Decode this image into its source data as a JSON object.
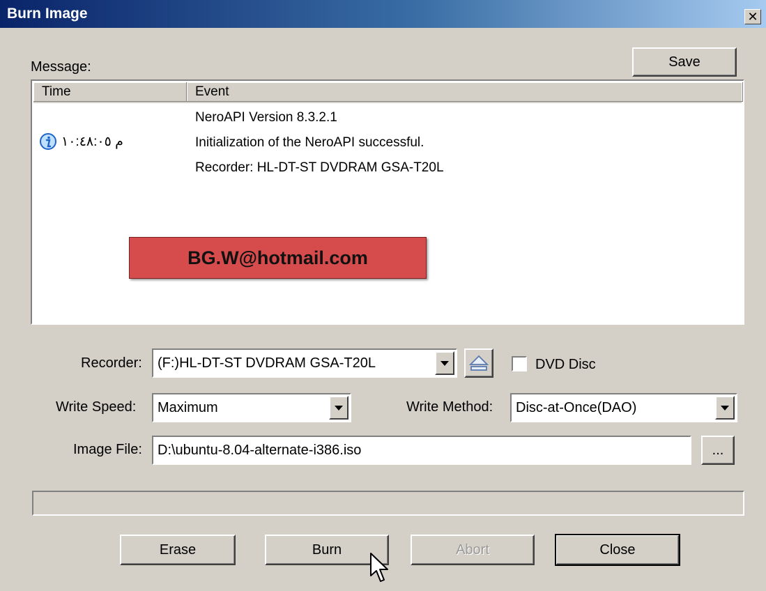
{
  "window": {
    "title": "Burn Image",
    "close_glyph": "✕"
  },
  "message": {
    "label": "Message:",
    "save_label": "Save",
    "columns": [
      "Time",
      "Event"
    ],
    "entry": {
      "icon": "info-icon",
      "time": "م ١٠:٤٨:٠٥",
      "events": [
        "NeroAPI Version 8.3.2.1",
        "Initialization of the NeroAPI successful.",
        "Recorder: HL-DT-ST DVDRAM GSA-T20L"
      ]
    },
    "watermark": "BG.W@hotmail.com"
  },
  "form": {
    "recorder_label": "Recorder:",
    "recorder_value": "(F:)HL-DT-ST DVDRAM GSA-T20L",
    "eject_icon": "eject-icon",
    "dvd_disc_label": "DVD Disc",
    "dvd_disc_checked": false,
    "write_speed_label": "Write Speed:",
    "write_speed_value": "Maximum",
    "write_method_label": "Write Method:",
    "write_method_value": "Disc-at-Once(DAO)",
    "image_file_label": "Image File:",
    "image_file_value": "D:\\ubuntu-8.04-alternate-i386.iso",
    "browse_label": "..."
  },
  "progress": {
    "value": 0
  },
  "buttons": {
    "erase": "Erase",
    "burn": "Burn",
    "abort": "Abort",
    "close": "Close"
  },
  "colors": {
    "face": "#d4d0c8",
    "title_start": "#0a246a",
    "title_end": "#a6caf0",
    "watermark_bg": "#d64c4c"
  }
}
